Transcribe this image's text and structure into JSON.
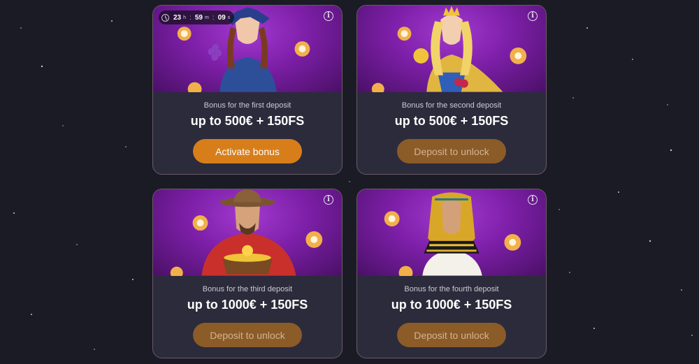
{
  "timer": {
    "hours": "23",
    "hours_unit": "h",
    "minutes": "59",
    "minutes_unit": "m",
    "seconds": "09",
    "seconds_unit": "s"
  },
  "cards": [
    {
      "label": "Bonus for the first deposit",
      "amount": "up to 500€ + 150FS",
      "button": "Activate bonus",
      "state": "active"
    },
    {
      "label": "Bonus for the second deposit",
      "amount": "up to 500€ + 150FS",
      "button": "Deposit to unlock",
      "state": "locked"
    },
    {
      "label": "Bonus for the third deposit",
      "amount": "up to 1000€ + 150FS",
      "button": "Deposit to unlock",
      "state": "locked"
    },
    {
      "label": "Bonus for the fourth deposit",
      "amount": "up to 1000€ + 150FS",
      "button": "Deposit to unlock",
      "state": "locked"
    }
  ],
  "icons": {
    "info": "info-icon",
    "timer": "clock-icon"
  },
  "colors": {
    "background": "#1b1b26",
    "card": "#2b2b3b",
    "hero": "#7d1fa8",
    "active_button": "#d77e1b",
    "locked_button": "#8b5b28"
  }
}
